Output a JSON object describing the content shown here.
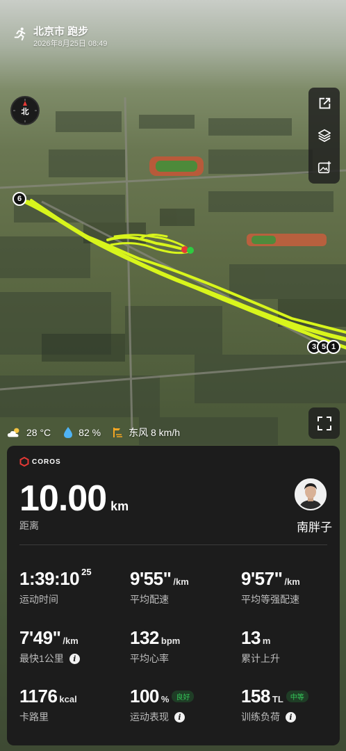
{
  "header": {
    "title": "北京市 跑步",
    "date": "2026年8月25日 08:49"
  },
  "compass": {
    "label": "北"
  },
  "map": {
    "markers": [
      "6",
      "3",
      "5",
      "1"
    ],
    "track_color": "#d8f51c"
  },
  "weather": {
    "temperature": "28 °C",
    "humidity": "82 %",
    "wind": "东风 8 km/h"
  },
  "card": {
    "brand": "COROS",
    "distance": {
      "value": "10.00",
      "unit": "km",
      "label": "距离"
    },
    "user": {
      "name": "南胖子"
    },
    "stats": [
      {
        "value": "1:39:10",
        "sup": "25",
        "unit": "",
        "label": "运动时间"
      },
      {
        "value": "9'55\"",
        "unit": "/km",
        "label": "平均配速"
      },
      {
        "value": "9'57\"",
        "unit": "/km",
        "label": "平均等强配速"
      },
      {
        "value": "7'49\"",
        "unit": "/km",
        "label": "最快1公里"
      },
      {
        "value": "132",
        "unit": "bpm",
        "label": "平均心率"
      },
      {
        "value": "13",
        "unit": "m",
        "label": "累计上升"
      },
      {
        "value": "1176",
        "unit": "kcal",
        "label": "卡路里"
      },
      {
        "value": "100",
        "unit": "%",
        "badge": "良好",
        "label": "运动表现"
      },
      {
        "value": "158",
        "unit": "TL",
        "badge": "中等",
        "label": "训练负荷"
      }
    ],
    "info_glyph": "i"
  },
  "icons": [
    "run-icon",
    "share-icon",
    "layers-icon",
    "image-icon",
    "fullscreen-icon",
    "cloud-sun-icon",
    "humidity-icon",
    "wind-icon",
    "coros-logo-icon",
    "info-icon"
  ],
  "colors": {
    "accent_green": "#34c759",
    "track": "#d8f51c",
    "card_bg": "#1c1c1c"
  }
}
